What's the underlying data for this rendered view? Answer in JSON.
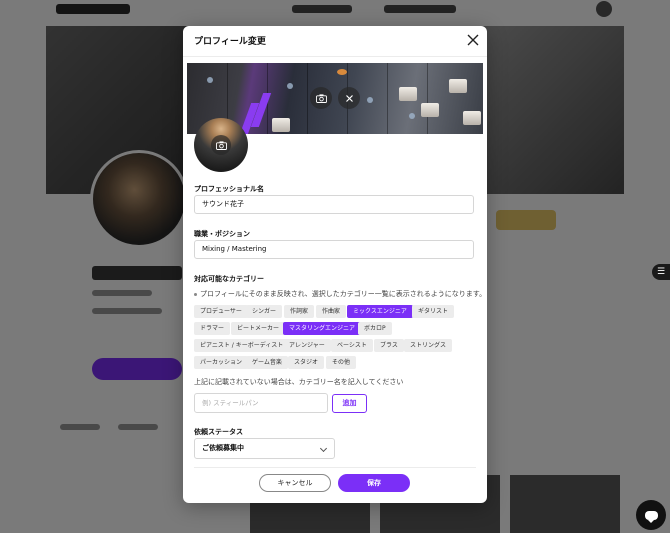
{
  "modal": {
    "title": "プロフィール変更",
    "display_name_label": "プロフェッショナル名",
    "display_name_value": "サウンド花子",
    "position_label": "職業・ポジション",
    "position_value": "Mixing / Mastering",
    "categories_label": "対応可能なカテゴリー",
    "categories_note": "プロフィールにそのまま反映され、選択したカテゴリー一覧に表示されるようになります。",
    "categories": [
      {
        "label": "プロデューサー",
        "selected": false
      },
      {
        "label": "シンガー",
        "selected": false
      },
      {
        "label": "作詞家",
        "selected": false
      },
      {
        "label": "作曲家",
        "selected": false
      },
      {
        "label": "ミックスエンジニア",
        "selected": true
      },
      {
        "label": "ギタリスト",
        "selected": false
      },
      {
        "label": "ドラマー",
        "selected": false
      },
      {
        "label": "ビートメーカー",
        "selected": false
      },
      {
        "label": "マスタリングエンジニア",
        "selected": true
      },
      {
        "label": "ボカロP",
        "selected": false
      },
      {
        "label": "ピアニスト / キーボーディスト",
        "selected": false
      },
      {
        "label": "アレンジャー",
        "selected": false
      },
      {
        "label": "ベーシスト",
        "selected": false
      },
      {
        "label": "ブラス",
        "selected": false
      },
      {
        "label": "ストリングス",
        "selected": false
      },
      {
        "label": "パーカッション",
        "selected": false
      },
      {
        "label": "ゲーム音楽",
        "selected": false
      },
      {
        "label": "スタジオ",
        "selected": false
      },
      {
        "label": "その他",
        "selected": false
      }
    ],
    "other_note": "上記に記載されていない場合は、カテゴリー名を記入してください",
    "other_placeholder": "例) スティールパン",
    "add_label": "追加",
    "status_label": "依頼ステータス",
    "status_value": "ご依頼募集中",
    "cancel_label": "キャンセル",
    "save_label": "保存"
  },
  "colors": {
    "accent": "#7b2ff7",
    "overlay": "rgba(0,0,0,0.52)"
  },
  "icons": {
    "close": "close-icon",
    "camera": "camera-icon",
    "remove": "remove-image-icon",
    "chevron": "chevron-down-icon",
    "chat": "chat-icon"
  }
}
